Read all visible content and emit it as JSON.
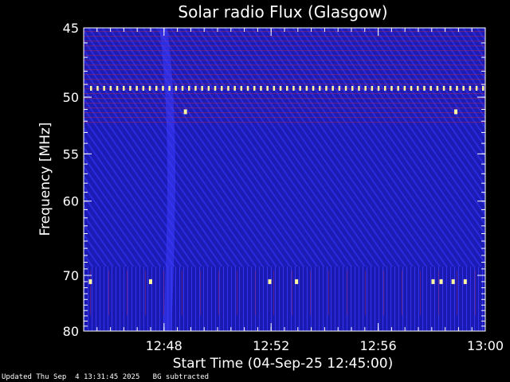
{
  "chart_data": {
    "type": "heatmap",
    "title": "Solar radio Flux (Glasgow)",
    "xlabel": "Start Time (04-Sep-25 12:45:00)",
    "ylabel": "Frequency [MHz]",
    "x_ticks": [
      "12:48",
      "12:52",
      "12:56",
      "13:00"
    ],
    "x_tick_minutes": [
      3,
      7,
      11,
      15
    ],
    "xlim_minutes": [
      0,
      15
    ],
    "y_ticks": [
      45,
      50,
      55,
      60,
      70,
      80
    ],
    "ylim": [
      45,
      80
    ],
    "y_scale": "reciprocal",
    "colors": {
      "background_blue": "#1c1cb4",
      "bright_blue": "#3c3cff",
      "red_band": "#b4284a",
      "burst": "#fff7a0"
    },
    "bursts": [
      {
        "time_minutes": 0.25,
        "freq": 71.0
      },
      {
        "time_minutes": 2.5,
        "freq": 71.0
      },
      {
        "time_minutes": 6.95,
        "freq": 71.0
      },
      {
        "time_minutes": 7.95,
        "freq": 71.0
      },
      {
        "time_minutes": 13.05,
        "freq": 71.0
      },
      {
        "time_minutes": 13.35,
        "freq": 71.0
      },
      {
        "time_minutes": 13.8,
        "freq": 71.0
      },
      {
        "time_minutes": 14.25,
        "freq": 71.0
      },
      {
        "time_minutes": 3.8,
        "freq": 51.2
      },
      {
        "time_minutes": 13.9,
        "freq": 51.2
      }
    ],
    "interference_line_freq": 49.3
  },
  "footer": {
    "updated": "Updated Thu Sep  4 13:31:45 2025",
    "note": "BG subtracted"
  }
}
